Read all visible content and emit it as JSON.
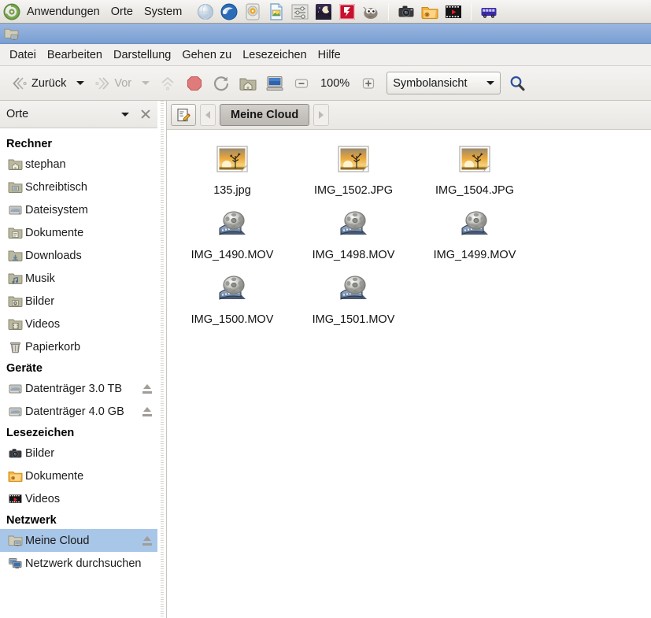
{
  "desktop_panel": {
    "logo_icon": "gnome-footprint-logo",
    "menus": [
      "Anwendungen",
      "Orte",
      "System"
    ],
    "launchers": [
      {
        "name": "web-browser-icon",
        "title": "Webbrowser"
      },
      {
        "name": "thunderbird-mail-icon",
        "title": "Thunderbird"
      },
      {
        "name": "media-disc-icon",
        "title": "Brasero"
      },
      {
        "name": "libreoffice-draw-icon",
        "title": "LibreOffice Draw"
      },
      {
        "name": "audio-mixer-icon",
        "title": "Mixer"
      },
      {
        "name": "stellarium-night-sky-icon",
        "title": "Stellarium"
      },
      {
        "name": "filezilla-icon",
        "title": "FileZilla"
      },
      {
        "name": "gimp-icon",
        "title": "GIMP"
      }
    ],
    "launchers_group2": [
      {
        "name": "camera-icon",
        "title": "Kamera"
      },
      {
        "name": "folder-archive-icon",
        "title": "Archiv"
      },
      {
        "name": "video-player-icon",
        "title": "Videoplayer"
      }
    ],
    "launchers_group3": [
      {
        "name": "bus-icon",
        "title": "Bus"
      }
    ]
  },
  "window": {
    "titlebar_icon": "network-folder-icon",
    "title": ""
  },
  "menubar": {
    "items": [
      "Datei",
      "Bearbeiten",
      "Darstellung",
      "Gehen zu",
      "Lesezeichen",
      "Hilfe"
    ]
  },
  "toolbar": {
    "back_label": "Zurück",
    "forward_label": "Vor",
    "zoom_level": "100%",
    "view_mode": "Symbolansicht",
    "buttons": [
      {
        "name": "up-button",
        "icon": "arrow-up-icon",
        "enabled": false
      },
      {
        "name": "stop-button",
        "icon": "stop-octagon-icon",
        "enabled": true
      },
      {
        "name": "reload-button",
        "icon": "reload-icon",
        "enabled": true
      },
      {
        "name": "home-button",
        "icon": "home-folder-icon",
        "enabled": true
      },
      {
        "name": "computer-button",
        "icon": "computer-monitor-icon",
        "enabled": true
      },
      {
        "name": "zoom-out-button",
        "icon": "minus-icon",
        "enabled": true
      },
      {
        "name": "zoom-in-button",
        "icon": "plus-icon",
        "enabled": true
      },
      {
        "name": "search-button",
        "icon": "magnifier-icon",
        "enabled": true
      }
    ]
  },
  "sidebar": {
    "title": "Orte",
    "close_icon": "close-icon",
    "dropdown_icon": "chevron-down-icon",
    "groups": [
      {
        "label": "Rechner",
        "items": [
          {
            "label": "stephan",
            "icon": "home-folder-icon",
            "eject": false,
            "selected": false
          },
          {
            "label": "Schreibtisch",
            "icon": "desktop-folder-icon",
            "eject": false,
            "selected": false
          },
          {
            "label": "Dateisystem",
            "icon": "drive-harddisk-icon",
            "eject": false,
            "selected": false
          },
          {
            "label": "Dokumente",
            "icon": "documents-folder-icon",
            "eject": false,
            "selected": false
          },
          {
            "label": "Downloads",
            "icon": "downloads-folder-icon",
            "eject": false,
            "selected": false
          },
          {
            "label": "Musik",
            "icon": "music-folder-icon",
            "eject": false,
            "selected": false
          },
          {
            "label": "Bilder",
            "icon": "pictures-folder-icon",
            "eject": false,
            "selected": false
          },
          {
            "label": "Videos",
            "icon": "videos-folder-icon",
            "eject": false,
            "selected": false
          },
          {
            "label": "Papierkorb",
            "icon": "trash-icon",
            "eject": false,
            "selected": false
          }
        ]
      },
      {
        "label": "Geräte",
        "items": [
          {
            "label": "Datenträger 3.0 TB",
            "icon": "drive-harddisk-icon",
            "eject": true,
            "selected": false
          },
          {
            "label": "Datenträger 4.0 GB",
            "icon": "drive-harddisk-icon",
            "eject": true,
            "selected": false
          }
        ]
      },
      {
        "label": "Lesezeichen",
        "items": [
          {
            "label": "Bilder",
            "icon": "camera-icon",
            "eject": false,
            "selected": false
          },
          {
            "label": "Dokumente",
            "icon": "folder-archive-icon",
            "eject": false,
            "selected": false
          },
          {
            "label": "Videos",
            "icon": "video-player-icon",
            "eject": false,
            "selected": false
          }
        ]
      },
      {
        "label": "Netzwerk",
        "items": [
          {
            "label": "Meine Cloud",
            "icon": "network-folder-icon",
            "eject": true,
            "selected": true
          },
          {
            "label": "Netzwerk durchsuchen",
            "icon": "network-browse-icon",
            "eject": false,
            "selected": false
          }
        ]
      }
    ]
  },
  "pathbar": {
    "edit_icon": "edit-location-icon",
    "prev_icon": "chevron-left-icon",
    "next_icon": "chevron-right-icon",
    "crumbs": [
      {
        "label": "Meine Cloud",
        "active": true
      }
    ]
  },
  "files": [
    {
      "name": "135.jpg",
      "icon": "image-thumbnail-icon",
      "type": "image"
    },
    {
      "name": "IMG_1502.JPG",
      "icon": "image-thumbnail-icon",
      "type": "image"
    },
    {
      "name": "IMG_1504.JPG",
      "icon": "image-thumbnail-icon",
      "type": "image"
    },
    {
      "name": "IMG_1490.MOV",
      "icon": "film-reel-icon",
      "type": "video"
    },
    {
      "name": "IMG_1498.MOV",
      "icon": "film-reel-icon",
      "type": "video"
    },
    {
      "name": "IMG_1499.MOV",
      "icon": "film-reel-icon",
      "type": "video"
    },
    {
      "name": "IMG_1500.MOV",
      "icon": "film-reel-icon",
      "type": "video"
    },
    {
      "name": "IMG_1501.MOV",
      "icon": "film-reel-icon",
      "type": "video"
    }
  ],
  "colors": {
    "titlebar_blue": "#8cacda",
    "selection_blue": "#a8c6e8",
    "panel_grey": "#ecebe7",
    "toolbar_grey": "#f0eeea",
    "text": "#1a1a1a"
  }
}
